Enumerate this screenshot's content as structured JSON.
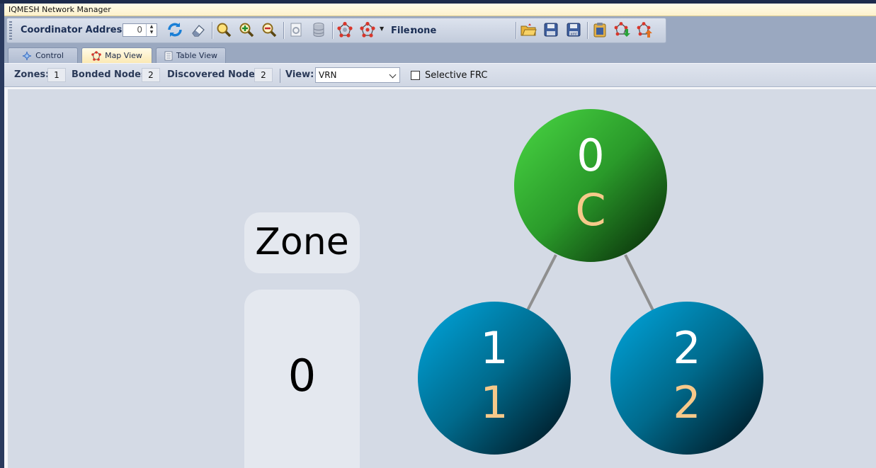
{
  "window": {
    "title": "IQMESH Network Manager"
  },
  "toolbar": {
    "coordinator_label": "Coordinator Address:",
    "coordinator_value": "0",
    "file_label": "File:",
    "file_value": "none",
    "icons": [
      "refresh-icon",
      "eraser-icon",
      "zoom-icon",
      "zoom-in-icon",
      "zoom-out-icon",
      "page-icon",
      "database-icon",
      "network-settings-icon",
      "network-options-icon",
      "open-folder-icon",
      "save-icon",
      "save-as-icon",
      "clipboard-icon",
      "network-download-icon",
      "network-upload-icon"
    ]
  },
  "tabs": [
    {
      "label": "Control",
      "active": false
    },
    {
      "label": "Map View",
      "active": true
    },
    {
      "label": "Table View",
      "active": false
    }
  ],
  "status": {
    "zones_label": "Zones:",
    "zones_value": "1",
    "bonded_label": "Bonded Nodes:",
    "bonded_value": "2",
    "discovered_label": "Discovered Nodes:",
    "discovered_value": "2",
    "view_label": "View:",
    "view_value": "VRN",
    "selective_frc_label": "Selective FRC",
    "selective_frc_checked": false
  },
  "map": {
    "zone_title": "Zone",
    "zone_value": "0",
    "nodes": [
      {
        "top": "0",
        "bottom": "C",
        "kind": "coordinator"
      },
      {
        "top": "1",
        "bottom": "1",
        "kind": "node"
      },
      {
        "top": "2",
        "bottom": "2",
        "kind": "node"
      }
    ],
    "colors": {
      "coordinator": "#3fbe3a",
      "node": "#0098c8",
      "number": "#ffffff",
      "label": "#f6c98a",
      "link": "#8f8f8f"
    }
  }
}
